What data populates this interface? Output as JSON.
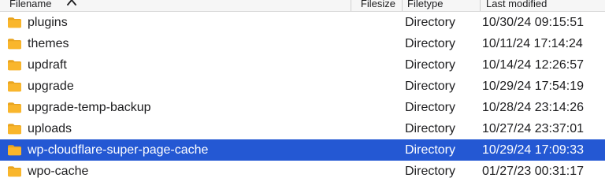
{
  "header": {
    "filename": "Filename",
    "filesize": "Filesize",
    "filetype": "Filetype",
    "last_modified": "Last modified",
    "sort_icon": "chevron-up-icon"
  },
  "rows": [
    {
      "name": "plugins",
      "type": "Directory",
      "modified": "10/30/24 09:15:51",
      "icon": "folder-icon",
      "selected": false
    },
    {
      "name": "themes",
      "type": "Directory",
      "modified": "10/11/24 17:14:24",
      "icon": "folder-icon",
      "selected": false
    },
    {
      "name": "updraft",
      "type": "Directory",
      "modified": "10/14/24 12:26:57",
      "icon": "folder-icon",
      "selected": false
    },
    {
      "name": "upgrade",
      "type": "Directory",
      "modified": "10/29/24 17:54:19",
      "icon": "folder-icon",
      "selected": false
    },
    {
      "name": "upgrade-temp-backup",
      "type": "Directory",
      "modified": "10/28/24 23:14:26",
      "icon": "folder-icon",
      "selected": false
    },
    {
      "name": "uploads",
      "type": "Directory",
      "modified": "10/27/24 23:37:01",
      "icon": "folder-icon",
      "selected": false
    },
    {
      "name": "wp-cloudflare-super-page-cache",
      "type": "Directory",
      "modified": "10/29/24 17:09:33",
      "icon": "folder-icon",
      "selected": true
    },
    {
      "name": "wpo-cache",
      "type": "Directory",
      "modified": "01/27/23 00:31:17",
      "icon": "folder-icon",
      "selected": false
    }
  ],
  "colors": {
    "selection": "#2458d3",
    "folder": "#f9b62c",
    "folder_tab": "#e9a41f"
  }
}
